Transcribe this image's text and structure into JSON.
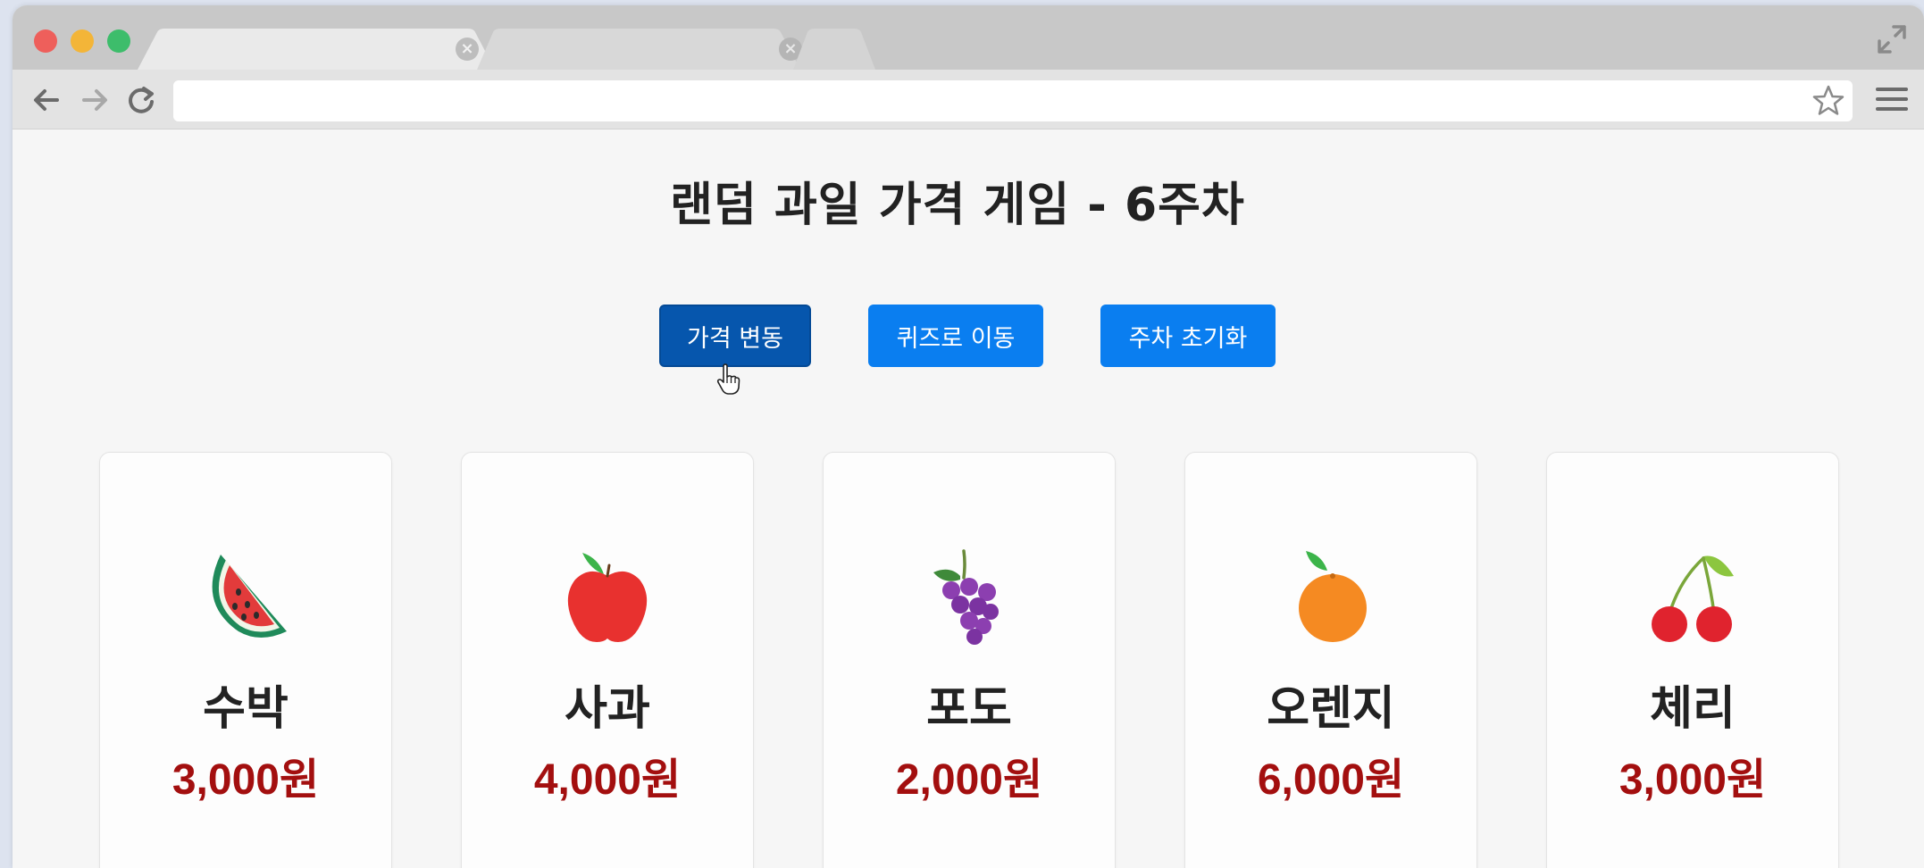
{
  "browser": {
    "address_value": "",
    "address_placeholder": ""
  },
  "page": {
    "title": "랜덤 과일 가격 게임 - 6주차"
  },
  "buttons": {
    "change": "가격 변동",
    "quiz": "퀴즈로 이동",
    "reset": "주차 초기화"
  },
  "colors": {
    "button_primary": "#0a7ef0",
    "button_pressed": "#0656ad",
    "price": "#a30f0f"
  },
  "fruits": [
    {
      "name": "수박",
      "price": "3,000원",
      "icon": "watermelon-icon"
    },
    {
      "name": "사과",
      "price": "4,000원",
      "icon": "apple-icon"
    },
    {
      "name": "포도",
      "price": "2,000원",
      "icon": "grapes-icon"
    },
    {
      "name": "오렌지",
      "price": "6,000원",
      "icon": "orange-icon"
    },
    {
      "name": "체리",
      "price": "3,000원",
      "icon": "cherries-icon"
    }
  ]
}
